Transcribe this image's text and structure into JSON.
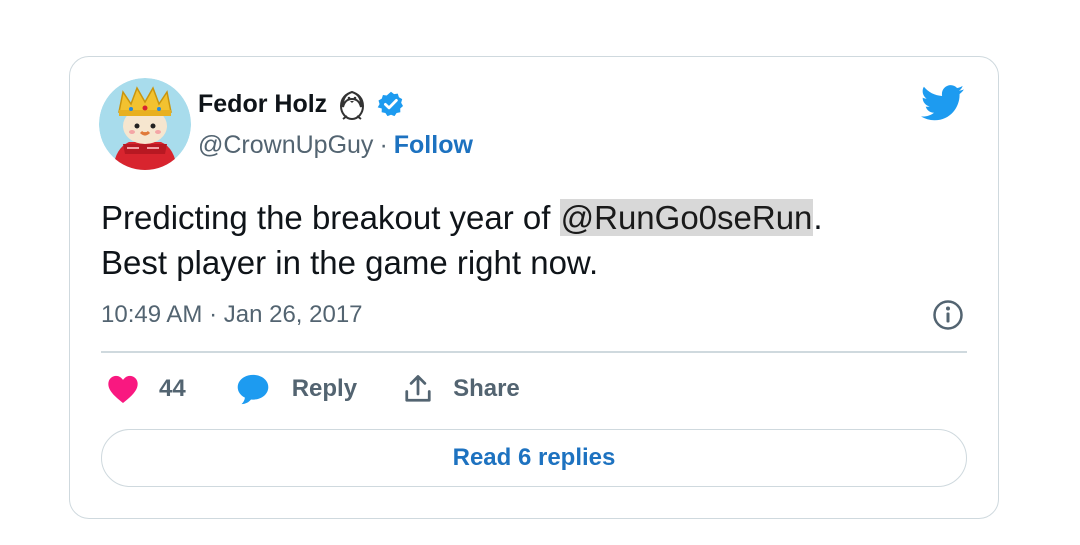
{
  "author": {
    "display_name": "Fedor Holz",
    "handle": "@CrownUpGuy",
    "separator": "·",
    "follow_label": "Follow"
  },
  "tweet": {
    "text_before": "Predicting the breakout year of ",
    "mention": "@RunGo0seRun",
    "text_after": ".",
    "line2": "Best player in the game right now.",
    "timestamp": "10:49 AM · Jan 26, 2017"
  },
  "actions": {
    "like_count": "44",
    "reply_label": "Reply",
    "share_label": "Share"
  },
  "read_replies_label": "Read 6 replies",
  "icons": [
    "avatar-king",
    "penguin-emoji",
    "verified-badge",
    "twitter-bird",
    "info-icon",
    "heart-icon",
    "reply-bubble-icon",
    "share-icon"
  ],
  "colors": {
    "twitter_blue": "#1d9bf0",
    "link_blue": "#1d72c0",
    "heart_pink": "#f91880",
    "secondary_text": "#536471",
    "border": "#cfd9de"
  }
}
